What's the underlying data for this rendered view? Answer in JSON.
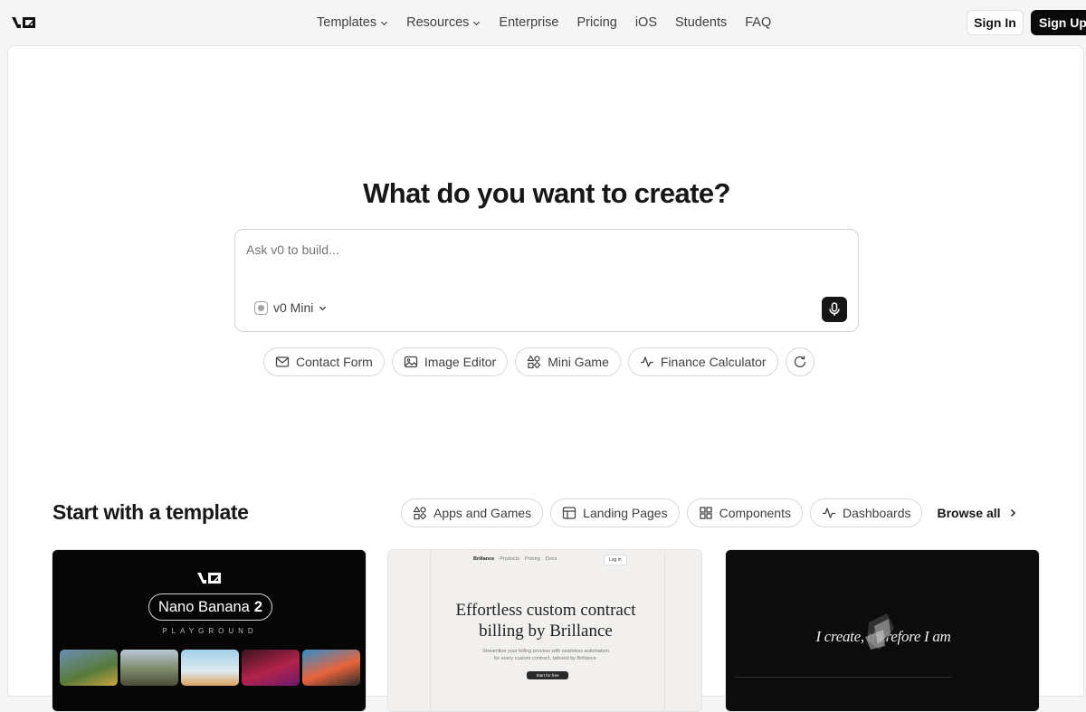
{
  "nav": {
    "links": [
      {
        "label": "Templates",
        "dropdown": true
      },
      {
        "label": "Resources",
        "dropdown": true
      },
      {
        "label": "Enterprise",
        "dropdown": false
      },
      {
        "label": "Pricing",
        "dropdown": false
      },
      {
        "label": "iOS",
        "dropdown": false
      },
      {
        "label": "Students",
        "dropdown": false
      },
      {
        "label": "FAQ",
        "dropdown": false
      }
    ],
    "sign_in": "Sign In",
    "sign_up": "Sign Up"
  },
  "hero": {
    "headline": "What do you want to create?",
    "prompt_placeholder": "Ask v0 to build...",
    "model": "v0 Mini"
  },
  "suggestions": [
    {
      "label": "Contact Form",
      "icon": "mail-icon"
    },
    {
      "label": "Image Editor",
      "icon": "image-icon"
    },
    {
      "label": "Mini Game",
      "icon": "shapes-icon"
    },
    {
      "label": "Finance Calculator",
      "icon": "activity-icon"
    }
  ],
  "templates": {
    "title": "Start with a template",
    "filters": [
      {
        "label": "Apps and Games",
        "icon": "shapes-icon"
      },
      {
        "label": "Landing Pages",
        "icon": "layout-icon"
      },
      {
        "label": "Components",
        "icon": "grid-icon"
      },
      {
        "label": "Dashboards",
        "icon": "activity-icon"
      }
    ],
    "browse_all": "Browse all",
    "cards": {
      "nano": {
        "pill_text": "Nano Banana",
        "pill_num": "2",
        "subtitle": "PLAYGROUND"
      },
      "brillance": {
        "nav_brand": "Brillance",
        "nav_links": [
          "Products",
          "Pricing",
          "Docs"
        ],
        "login": "Log in",
        "title_line1": "Effortless custom contract",
        "title_line2": "billing by Brillance",
        "sub_line1": "Streamline your billing process with seamless automation",
        "sub_line2": "for every custom contract, tailored by Brillance.",
        "cta": "Start for free"
      },
      "portfolio": {
        "text": "I create, therefore I am"
      }
    }
  },
  "colors": {
    "accent_dark": "#0a0a0a",
    "border": "#d9d9d9",
    "muted_text": "#404040"
  }
}
